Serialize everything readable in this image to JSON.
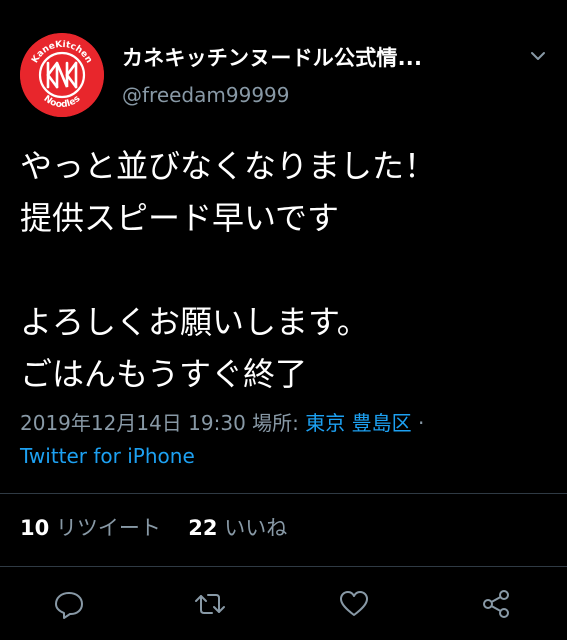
{
  "tweet": {
    "display_name": "カネキッチンヌードル公式情...",
    "handle": "@freedam99999",
    "avatar": {
      "ring_text_top": "KaneKitchen",
      "ring_text_bottom": "Noodles",
      "monogram": "KNK",
      "background_color": "#e8262c"
    },
    "text_lines": [
      "やっと並びなくなりました！",
      "提供スピード早いです",
      "",
      "よろしくお願いします。",
      "ごはんもうすぐ終了"
    ],
    "timestamp": "2019年12月14日 19:30",
    "location_label": "場所: ",
    "location_city": "東京",
    "location_ward": "豊島区",
    "separator": "·",
    "source": "Twitter for iPhone"
  },
  "stats": {
    "retweets_count": "10",
    "retweets_label": "リツイート",
    "likes_count": "22",
    "likes_label": "いいね"
  },
  "actions": [
    "reply-icon",
    "retweet-icon",
    "like-icon",
    "share-icon"
  ],
  "colors": {
    "background": "#000000",
    "primary_text": "#ffffff",
    "secondary_text": "#8899a6",
    "link": "#1da1f2",
    "divider": "#2f3a44"
  }
}
